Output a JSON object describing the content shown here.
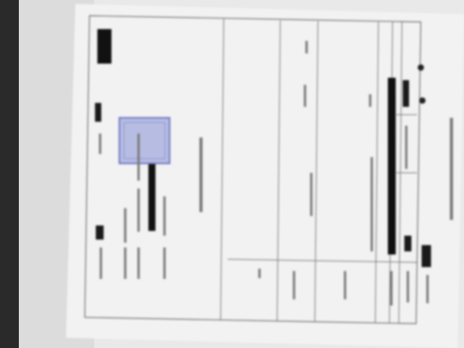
{
  "document": {
    "orientation": "rotated-90-degrees",
    "title": "",
    "header_lines": [
      "",
      "",
      "",
      ""
    ],
    "stamp_text": "",
    "table": {
      "left_column_text": "",
      "column_labels": [
        "",
        "",
        "",
        "",
        "",
        ""
      ],
      "bottom_row_labels": [
        "",
        "",
        "",
        "",
        ""
      ]
    },
    "right_margin_text": "",
    "bottom_right_label": ""
  },
  "colors": {
    "paper": "#f2f2f2",
    "ink": "#1a1a1a",
    "grid_line": "#6a6a6a",
    "stamp_fill": "#b7bde2",
    "stamp_border": "#6f79c2"
  }
}
